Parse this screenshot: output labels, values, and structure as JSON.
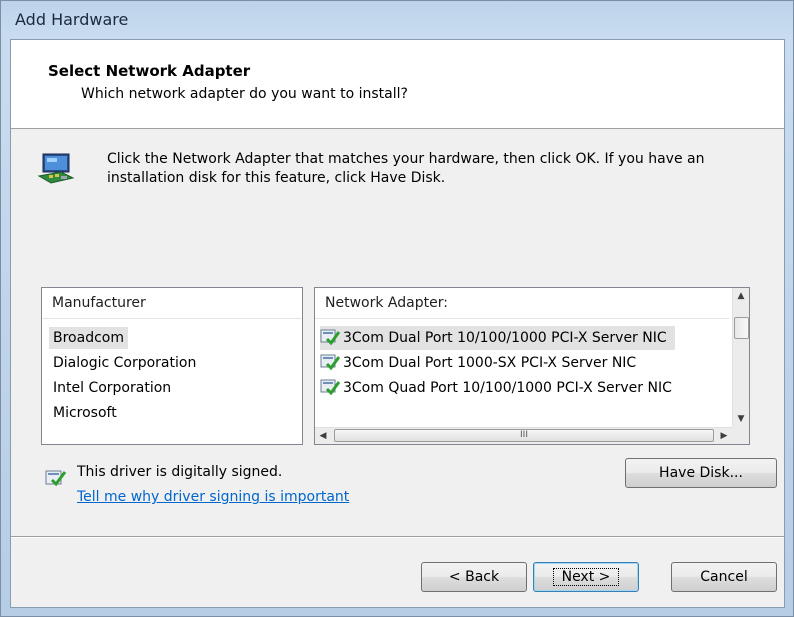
{
  "window": {
    "title": "Add Hardware"
  },
  "header": {
    "title": "Select Network Adapter",
    "subtitle": "Which network adapter do you want to install?"
  },
  "instruction": "Click the Network Adapter that matches your hardware, then click OK. If you have an installation disk for this feature, click Have Disk.",
  "manufacturer_list": {
    "header": "Manufacturer",
    "items": [
      "Broadcom",
      "Dialogic Corporation",
      "Intel Corporation",
      "Microsoft"
    ],
    "selected_index": 0
  },
  "adapter_list": {
    "header": "Network Adapter:",
    "items": [
      "3Com Dual Port 10/100/1000 PCI-X Server NIC",
      "3Com Dual Port 1000-SX PCI-X Server NIC",
      "3Com Quad Port 10/100/1000 PCI-X Server NIC"
    ],
    "selected_index": 0,
    "hscroll_grip": "III"
  },
  "signing": {
    "status": "This driver is digitally signed.",
    "link": "Tell me why driver signing is important"
  },
  "buttons": {
    "have_disk": "Have Disk...",
    "back": "< Back",
    "next": "Next >",
    "cancel": "Cancel"
  },
  "icons": {
    "adapter": "network-adapter-icon",
    "signed": "signed-driver-icon"
  },
  "colors": {
    "link": "#0066cc",
    "signed_check": "#2e9e2e",
    "title_bar": "#bdd3ea"
  }
}
